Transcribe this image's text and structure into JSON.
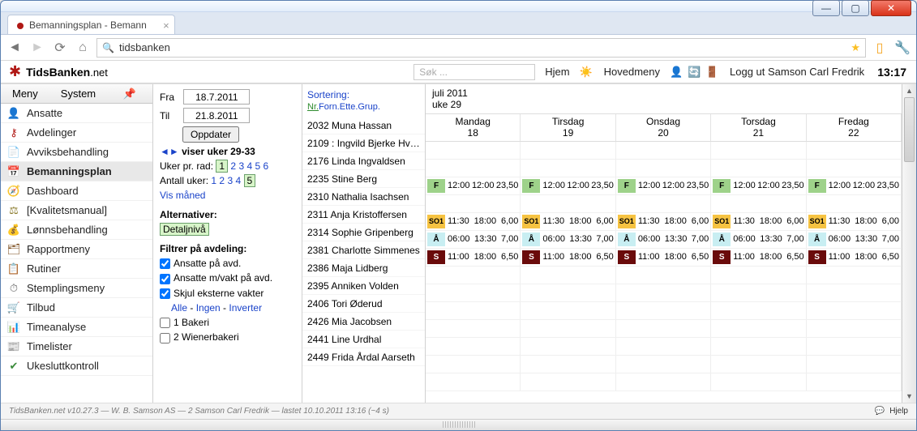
{
  "browser": {
    "tab_title": "Bemanningsplan - Bemann",
    "url_text": "tidsbanken"
  },
  "appbar": {
    "brand_bold": "TidsBanken",
    "brand_suffix": ".net",
    "search_placeholder": "Søk ...",
    "links": {
      "hjem": "Hjem",
      "hovedmeny": "Hovedmeny",
      "loggut": "Logg ut Samson Carl Fredrik"
    },
    "clock": "13:17"
  },
  "menubar": {
    "meny": "Meny",
    "system": "System"
  },
  "sidebar": [
    {
      "label": "Ansatte",
      "icon": "👤",
      "color": "#3a6bd8"
    },
    {
      "label": "Avdelinger",
      "icon": "⚷",
      "color": "#b01815"
    },
    {
      "label": "Avviksbehandling",
      "icon": "📄",
      "color": "#5a5a5a"
    },
    {
      "label": "Bemanningsplan",
      "icon": "📅",
      "color": "#3a6bd8",
      "active": true
    },
    {
      "label": "Dashboard",
      "icon": "🧭",
      "color": "#3a6bd8"
    },
    {
      "label": "[Kvalitetsmanual]",
      "icon": "⚖",
      "color": "#8a7a2a"
    },
    {
      "label": "Lønnsbehandling",
      "icon": "💰",
      "color": "#c08a2a"
    },
    {
      "label": "Rapportmeny",
      "icon": "🗂",
      "color": "#7a4a1a"
    },
    {
      "label": "Rutiner",
      "icon": "📋",
      "color": "#c99a4a"
    },
    {
      "label": "Stemplingsmeny",
      "icon": "⏱",
      "color": "#6a6a6a"
    },
    {
      "label": "Tilbud",
      "icon": "🛒",
      "color": "#6aa03a"
    },
    {
      "label": "Timeanalyse",
      "icon": "📊",
      "color": "#c85a3a"
    },
    {
      "label": "Timelister",
      "icon": "📰",
      "color": "#4a6ac8"
    },
    {
      "label": "Ukesluttkontroll",
      "icon": "✔",
      "color": "#3a8a3a"
    }
  ],
  "opts": {
    "fra_label": "Fra",
    "fra": "18.7.2011",
    "til_label": "Til",
    "til": "21.8.2011",
    "oppdater": "Oppdater",
    "viser": "viser uker 29-33",
    "uker_pr_rad_label": "Uker pr. rad:",
    "uker_pr_rad": [
      "1",
      "2",
      "3",
      "4",
      "5",
      "6"
    ],
    "uker_sel": 0,
    "antall_uker_label": "Antall uker:",
    "antall_uker": [
      "1",
      "2",
      "3",
      "4",
      "5"
    ],
    "antall_sel": 4,
    "vis_maned": "Vis måned",
    "alt_hdr": "Alternativer:",
    "detaljniva": "Detaljnivå",
    "filter_hdr": "Filtrer på avdeling:",
    "f1": "Ansatte på avd.",
    "f2": "Ansatte m/vakt på avd.",
    "f3": "Skjul eksterne vakter",
    "alle": "Alle",
    "ingen": "Ingen",
    "inverter": "Inverter",
    "dep1": "1 Bakeri",
    "dep2": "2 Wienerbakeri"
  },
  "sort": {
    "hdr": "Sortering:",
    "opts": [
      "Nr.",
      "Forn.",
      "Ette.",
      "Grup."
    ],
    "sel": 0
  },
  "grid_header": {
    "month": "juli 2011",
    "week": "uke 29"
  },
  "days": [
    {
      "name": "Mandag",
      "num": "18"
    },
    {
      "name": "Tirsdag",
      "num": "19"
    },
    {
      "name": "Onsdag",
      "num": "20"
    },
    {
      "name": "Torsdag",
      "num": "21"
    },
    {
      "name": "Fredag",
      "num": "22"
    }
  ],
  "employees": [
    {
      "id": "2032",
      "name": "Muna Hassan"
    },
    {
      "id": "2109",
      "name": ": Ingvild Bjerke Hvalby"
    },
    {
      "id": "2176",
      "name": "Linda Ingvaldsen",
      "shift": {
        "code": "F",
        "t1": "12:00",
        "t2": "12:00",
        "h": "23,50"
      }
    },
    {
      "id": "2235",
      "name": "Stine Berg"
    },
    {
      "id": "2310",
      "name": "Nathalia Isachsen",
      "shift": {
        "code": "SO1",
        "t1": "11:30",
        "t2": "18:00",
        "h": "6,00"
      }
    },
    {
      "id": "2311",
      "name": "Anja Kristoffersen",
      "shift": {
        "code": "Å",
        "t1": "06:00",
        "t2": "13:30",
        "h": "7,00"
      }
    },
    {
      "id": "2314",
      "name": "Sophie Gripenberg",
      "shift": {
        "code": "S",
        "t1": "11:00",
        "t2": "18:00",
        "h": "6,50"
      }
    },
    {
      "id": "2381",
      "name": "Charlotte Simmenes"
    },
    {
      "id": "2386",
      "name": "Maja Lidberg"
    },
    {
      "id": "2395",
      "name": "Anniken Volden"
    },
    {
      "id": "2406",
      "name": "Tori Øderud"
    },
    {
      "id": "2426",
      "name": "Mia Jacobsen"
    },
    {
      "id": "2441",
      "name": "Line Urdhal"
    },
    {
      "id": "2449",
      "name": "Frida Årdal Aarseth"
    }
  ],
  "status": "TidsBanken.net v10.27.3 — W. B. Samson AS — 2 Samson Carl Fredrik — lastet 10.10.2011 13:16 (~4 s)",
  "help": "Hjelp"
}
